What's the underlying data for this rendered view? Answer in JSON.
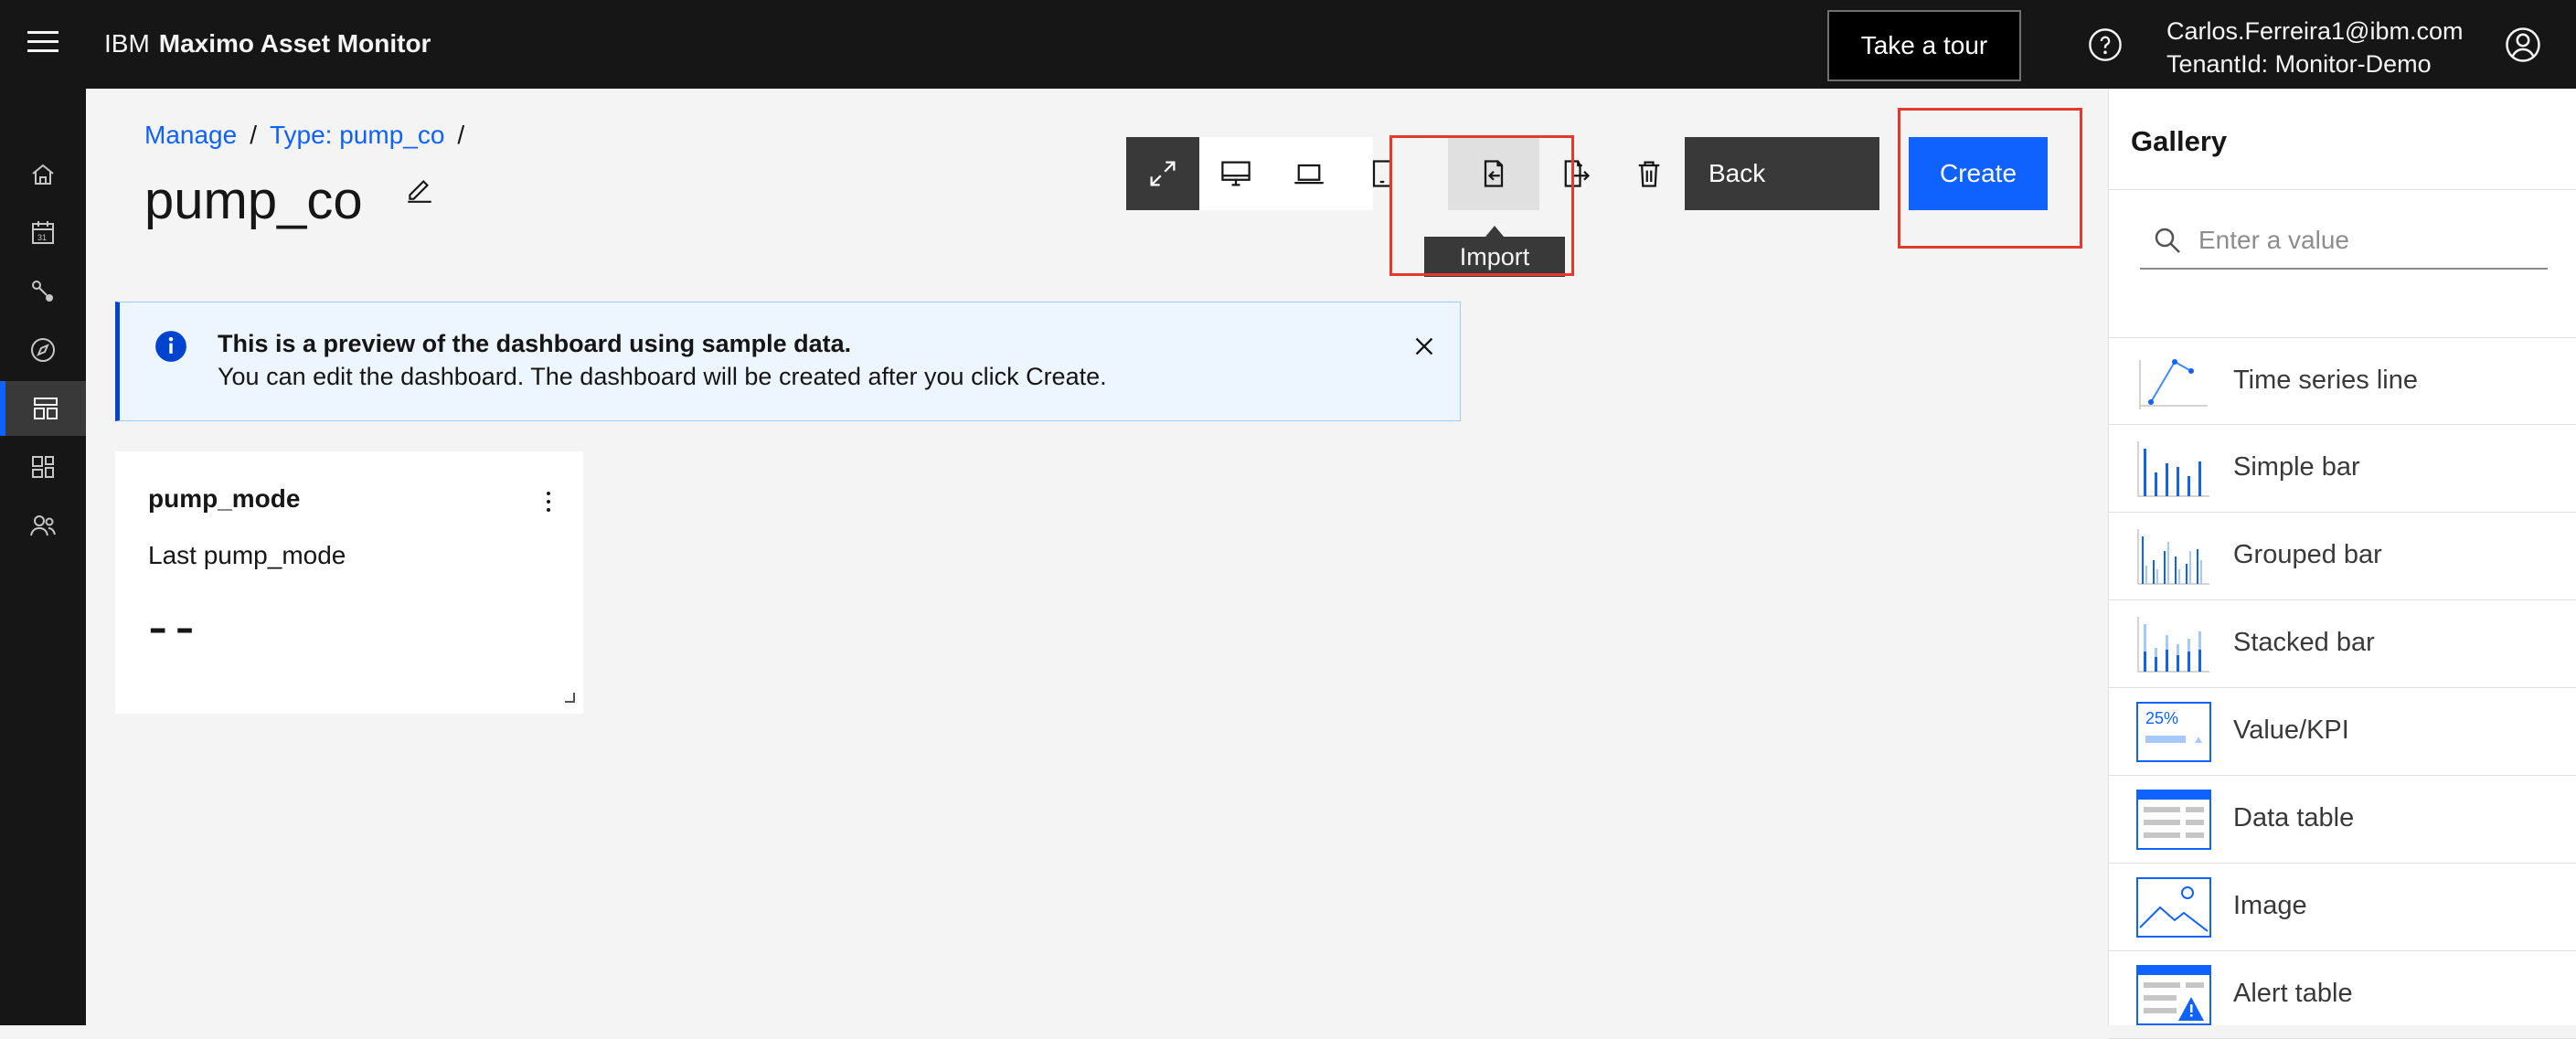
{
  "header": {
    "ibm": "IBM",
    "product": "Maximo Asset Monitor",
    "tour_label": "Take a tour",
    "user_email": "Carlos.Ferreira1@ibm.com",
    "tenant": "TenantId: Monitor-Demo"
  },
  "nav": {
    "items": [
      "home-icon",
      "calendar-icon",
      "connections-icon",
      "explore-icon",
      "dashboard-icon",
      "devices-icon",
      "users-icon"
    ],
    "active": "dashboard-icon"
  },
  "breadcrumb": {
    "items": [
      "Manage",
      "Type: pump_co"
    ],
    "separator": "/"
  },
  "page": {
    "title": "pump_co"
  },
  "toolbar": {
    "icons": [
      "fit-to-screen-icon",
      "desktop-icon",
      "laptop-icon",
      "tablet-icon",
      "import-icon",
      "export-icon",
      "trash-icon"
    ],
    "import_tooltip": "Import",
    "back_label": "Back",
    "create_label": "Create"
  },
  "notification": {
    "title": "This is a preview of the dashboard using sample data.",
    "body": "You can edit the dashboard. The dashboard will be created after you click Create."
  },
  "card": {
    "title": "pump_mode",
    "label": "Last pump_mode",
    "value": "--"
  },
  "gallery": {
    "title": "Gallery",
    "search_placeholder": "Enter a value",
    "items": [
      {
        "label": "Time series line",
        "icon": "time-series-line-icon"
      },
      {
        "label": "Simple bar",
        "icon": "simple-bar-icon"
      },
      {
        "label": "Grouped bar",
        "icon": "grouped-bar-icon"
      },
      {
        "label": "Stacked bar",
        "icon": "stacked-bar-icon"
      },
      {
        "label": "Value/KPI",
        "icon": "value-kpi-icon",
        "thumb_text": "25%"
      },
      {
        "label": "Data table",
        "icon": "data-table-icon"
      },
      {
        "label": "Image",
        "icon": "image-icon"
      },
      {
        "label": "Alert table",
        "icon": "alert-table-icon"
      }
    ]
  },
  "colors": {
    "accent": "#0f62fe",
    "highlight": "#e23b2e",
    "header_bg": "#161616"
  }
}
